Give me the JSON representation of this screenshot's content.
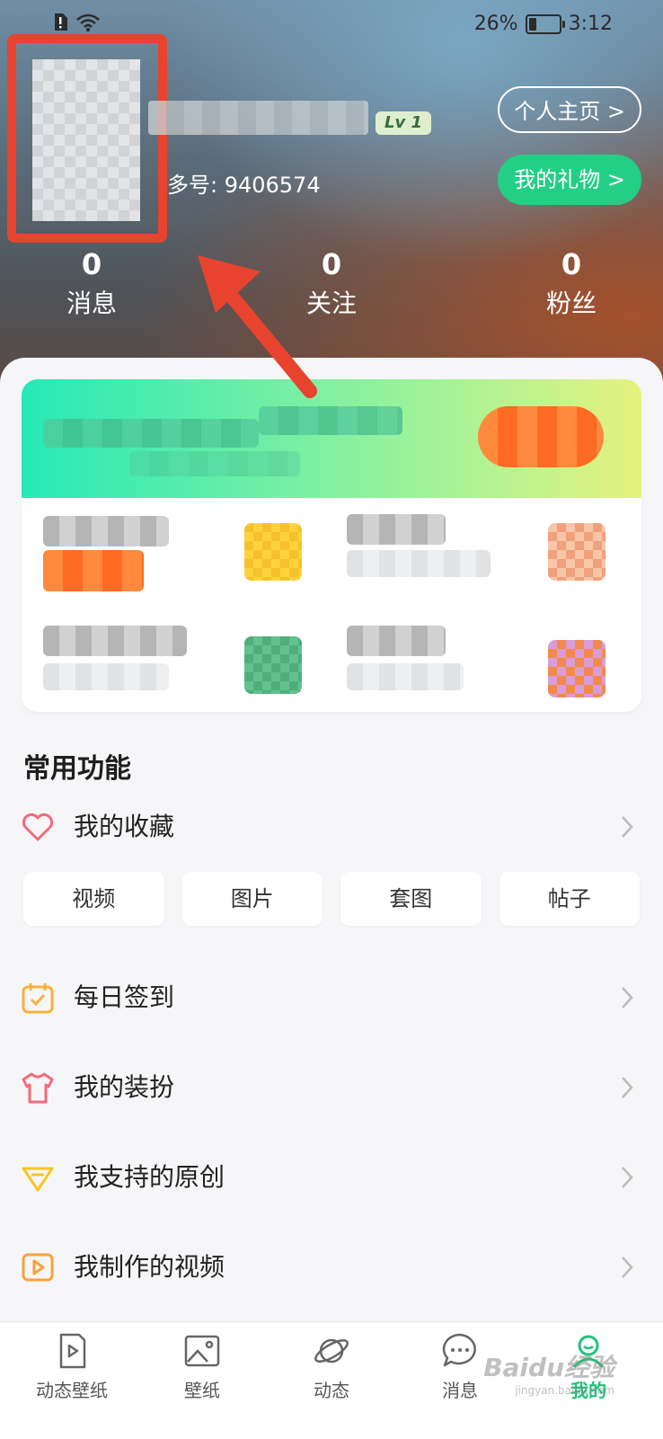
{
  "status_bar": {
    "battery": "26%",
    "time": "3:12",
    "battery_level": 0.26
  },
  "profile": {
    "level": "Lv 1",
    "uid_text": "多号: 9406574",
    "profile_button": "个人主页 >",
    "gift_button": "我的礼物 >"
  },
  "stats": [
    {
      "count": "0",
      "label": "消息"
    },
    {
      "count": "0",
      "label": "关注"
    },
    {
      "count": "0",
      "label": "粉丝"
    }
  ],
  "common": {
    "title": "常用功能",
    "favorites": {
      "label": "我的收藏",
      "icon": "heart-icon"
    },
    "favorite_types": [
      "视频",
      "图片",
      "套图",
      "帖子"
    ],
    "items": [
      {
        "label": "每日签到",
        "icon": "calendar-check-icon"
      },
      {
        "label": "我的装扮",
        "icon": "tshirt-icon"
      },
      {
        "label": "我支持的原创",
        "icon": "diamond-icon"
      },
      {
        "label": "我制作的视频",
        "icon": "video-play-icon"
      }
    ]
  },
  "tabs": [
    {
      "label": "动态壁纸",
      "icon": "live-wallpaper-icon"
    },
    {
      "label": "壁纸",
      "icon": "image-icon"
    },
    {
      "label": "动态",
      "icon": "planet-icon"
    },
    {
      "label": "消息",
      "icon": "chat-bubble-icon"
    },
    {
      "label": "我的",
      "icon": "user-icon",
      "active": true
    }
  ],
  "watermark": {
    "brand": "Baidu经验",
    "url": "jingyan.baidu.com"
  },
  "colors": {
    "accent_green": "#22cf85",
    "highlight_red": "#e8432f",
    "tab_active": "#1ec27a"
  }
}
